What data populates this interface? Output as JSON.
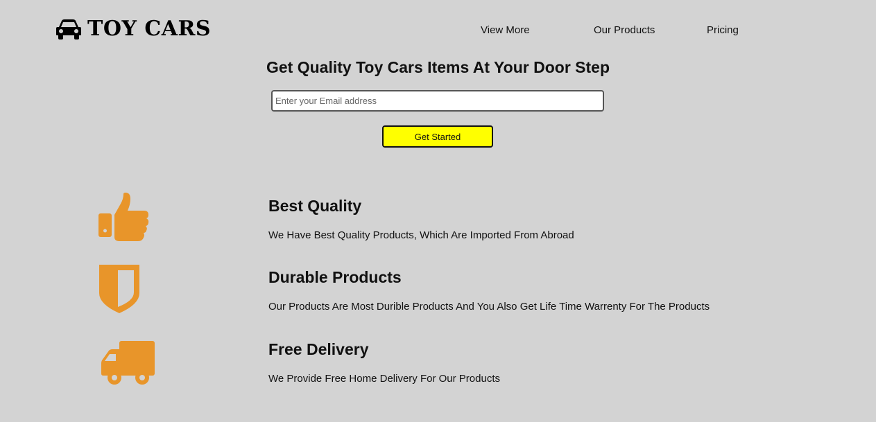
{
  "header": {
    "logo_text": "TOY CARS",
    "logo_icon": "car-icon",
    "nav": [
      {
        "label": "View More"
      },
      {
        "label": "Our Products"
      },
      {
        "label": "Pricing"
      }
    ]
  },
  "hero": {
    "title": "Get Quality Toy Cars Items At Your Door Step",
    "email_placeholder": "Enter your Email address",
    "email_value": "",
    "button_label": "Get Started",
    "button_color": "#ffff00"
  },
  "features": [
    {
      "icon": "thumbs-up-icon",
      "title": "Best Quality",
      "description": "We Have Best Quality Products, Which Are Imported From Abroad"
    },
    {
      "icon": "shield-icon",
      "title": "Durable Products",
      "description": "Our Products Are Most Durible Products And You Also Get Life Time Warrenty For The Products"
    },
    {
      "icon": "delivery-truck-icon",
      "title": "Free Delivery",
      "description": "We Provide Free Home Delivery For Our Products"
    }
  ],
  "colors": {
    "background": "#d3d3d3",
    "icon_orange": "#e8952a",
    "accent_yellow": "#ffff00"
  }
}
